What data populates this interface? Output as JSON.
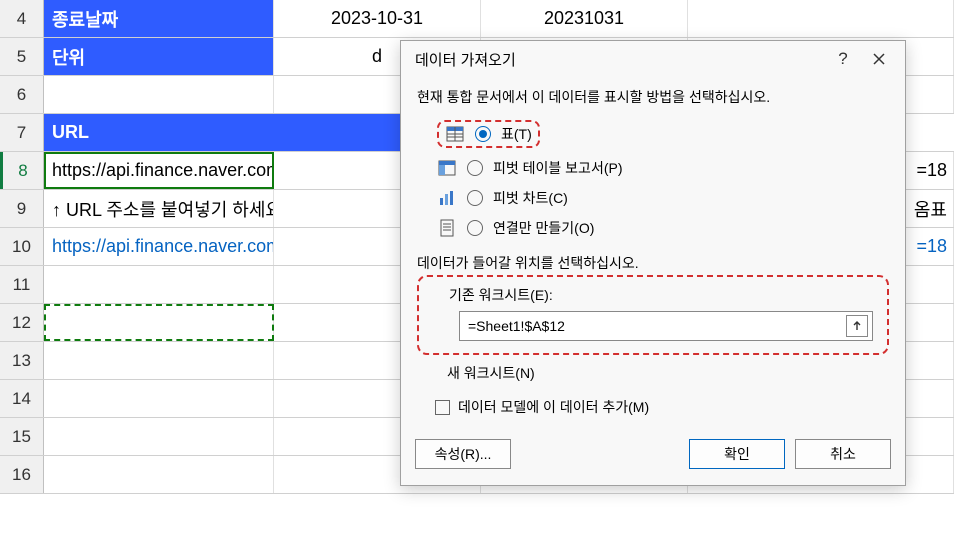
{
  "sheet": {
    "rows": [
      {
        "num": "4",
        "b": "종료날짜",
        "c": "2023-10-31",
        "d": "20231031",
        "b_class": "header-blue"
      },
      {
        "num": "5",
        "b": "단위",
        "c": "d",
        "d": "",
        "b_class": "header-blue"
      },
      {
        "num": "6",
        "b": "",
        "c": "",
        "d": ""
      },
      {
        "num": "7",
        "b": "URL",
        "c": "",
        "d": "",
        "b_class": "header-blue",
        "wide": true
      },
      {
        "num": "8",
        "b": "https://api.finance.naver.com/",
        "c": "",
        "d": "",
        "selected": true,
        "rest": "=18"
      },
      {
        "num": "9",
        "b": "↑ URL 주소를 붙여넣기 하세요",
        "c": "",
        "d": "",
        "rest": "옴표"
      },
      {
        "num": "10",
        "b": "https://api.finance.naver.com/",
        "c": "",
        "d": "",
        "link": true,
        "rest": "=18",
        "restlink": true
      },
      {
        "num": "11",
        "b": "",
        "c": "",
        "d": ""
      },
      {
        "num": "12",
        "b": "",
        "c": "",
        "d": "",
        "dashed": true
      },
      {
        "num": "13",
        "b": "",
        "c": "",
        "d": ""
      },
      {
        "num": "14",
        "b": "",
        "c": "",
        "d": ""
      },
      {
        "num": "15",
        "b": "",
        "c": "",
        "d": ""
      },
      {
        "num": "16",
        "b": "",
        "c": "",
        "d": ""
      }
    ]
  },
  "dialog": {
    "title": "데이터 가져오기",
    "help": "?",
    "instruction": "현재 통합 문서에서 이 데이터를 표시할 방법을 선택하십시오.",
    "opt_table": "표(T)",
    "opt_pivot": "피벗 테이블 보고서(P)",
    "opt_chart": "피벗 차트(C)",
    "opt_conn": "연결만 만들기(O)",
    "location_label": "데이터가 들어갈 위치를 선택하십시오.",
    "opt_existing": "기존 워크시트(E):",
    "cell_ref": "=Sheet1!$A$12",
    "opt_new": "새 워크시트(N)",
    "chk_model": "데이터 모델에 이 데이터 추가(M)",
    "btn_props": "속성(R)...",
    "btn_ok": "확인",
    "btn_cancel": "취소"
  }
}
